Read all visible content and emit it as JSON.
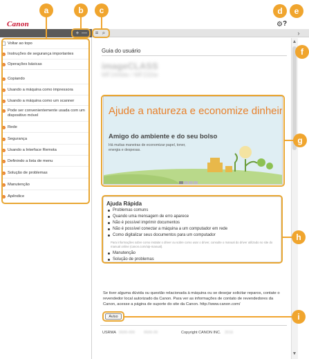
{
  "brand": {
    "logo_text": "Canon"
  },
  "toolbar": {
    "expand_label": "+",
    "collapse_label": "—",
    "contents_icon": "list-icon",
    "search_icon": "search-icon",
    "settings_icon": "gear-icon",
    "help_label": "?",
    "hide_panel_label": "›"
  },
  "sidebar": {
    "items": [
      {
        "label": "Voltar ao topo",
        "icon": "home-icon"
      },
      {
        "label": "Instruções de segurança importantes",
        "icon": "chevron-right-icon"
      },
      {
        "label": "Operações básicas",
        "icon": "chevron-right-icon"
      },
      {
        "label": "Copiando",
        "icon": "chevron-right-icon"
      },
      {
        "label": "Usando a máquina como impressora",
        "icon": "chevron-right-icon"
      },
      {
        "label": "Usando a máquina como um scanner",
        "icon": "chevron-right-icon"
      },
      {
        "label": "Pode ser convenientemente usada com um dispositivo móvel",
        "icon": "chevron-right-icon"
      },
      {
        "label": "Rede",
        "icon": "chevron-right-icon"
      },
      {
        "label": "Segurança",
        "icon": "chevron-right-icon"
      },
      {
        "label": "Usando a Interface Remota",
        "icon": "chevron-right-icon"
      },
      {
        "label": "Definindo a lista de menu",
        "icon": "chevron-right-icon"
      },
      {
        "label": "Solução de problemas",
        "icon": "chevron-right-icon"
      },
      {
        "label": "Manutenção",
        "icon": "chevron-right-icon"
      },
      {
        "label": "Apêndice",
        "icon": "chevron-right-icon"
      }
    ]
  },
  "main": {
    "heading": "Guia do usuário",
    "model_name": "imageCLASS",
    "model_sub": "MF244dw / MF232w",
    "banner": {
      "title": "Ajude a natureza e economize dinheiro",
      "subtitle": "Amigo do ambiente e do seu bolso",
      "text": "Há muitas maneiras de economizar papel, toner, energia e despesas.",
      "slides": [
        "1",
        "2",
        "3",
        "4"
      ]
    },
    "quick_help": {
      "title": "Ajuda Rápida",
      "items": [
        "Problemas comuns",
        "Quando uma mensagem de erro aparece",
        "Não é possível imprimir documentos",
        "Não é possível conectar a máquina a um computador em rede",
        "Como digitalizar seus documentos para um computador"
      ],
      "note": "Para informações sobre como instalar o driver ou sobre como usar o driver, consulte o manual do driver utilizado no site do manual online (canon.com/oip-manual).",
      "extra_items": [
        "Manutenção",
        "Solução de problemas"
      ]
    },
    "contact_text": "Se tiver alguma dúvida ou questão relacionada à máquina ou se desejar solicitar reparos, contate o revendedor local autorizado da Canon. Para ver as informações de contato de revendedores da Canon, acesse a página de suporte do site da Canon. http://www.canon.com/",
    "notice_button": "Aviso",
    "footer": {
      "code": "USRMA",
      "code_num": "0000-000",
      "date": "0000-00",
      "copyright": "Copyright CANON INC.",
      "year": "2016"
    }
  },
  "callouts": [
    "a",
    "b",
    "c",
    "d",
    "e",
    "f",
    "g",
    "h",
    "i"
  ],
  "colors": {
    "accent": "#f0a52e",
    "brand": "#c8102e",
    "banner_title": "#e8802a"
  }
}
